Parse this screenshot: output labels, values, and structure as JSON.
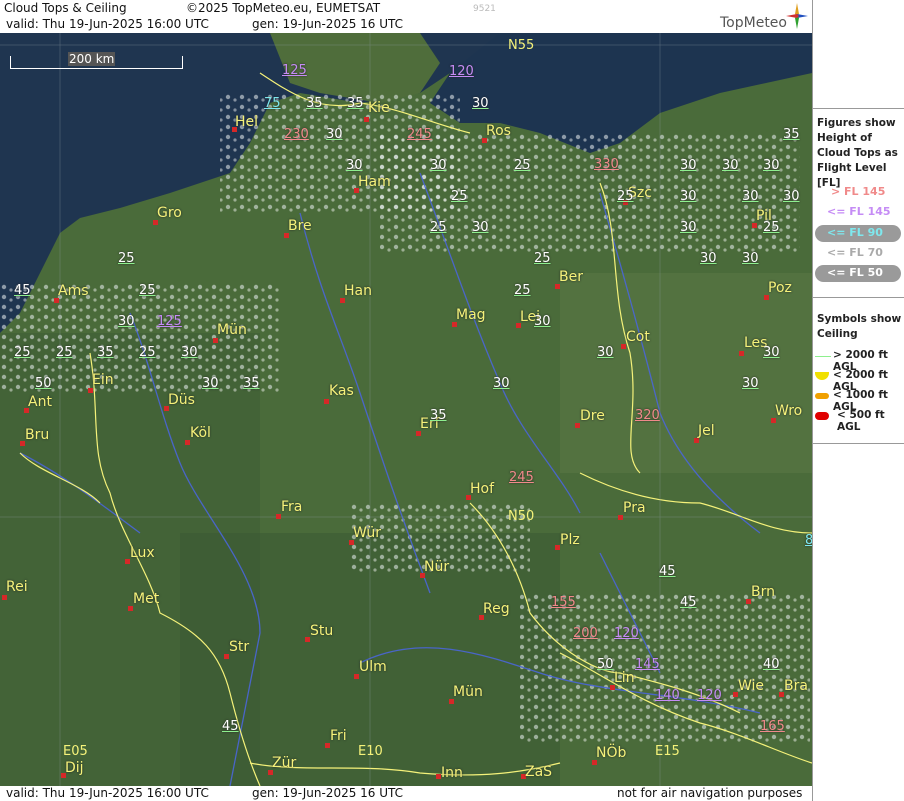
{
  "header": {
    "title": "Cloud Tops & Ceiling",
    "copyright": "©2025 TopMeteo.eu, EUMETSAT",
    "valid": "valid:  Thu  19-Jun-2025  16:00 UTC",
    "gen": "gen: 19-Jun-2025 16 UTC",
    "image_id": "9521",
    "logo": "TopMeteo"
  },
  "footer": {
    "valid": "valid:  Thu  19-Jun-2025  16:00 UTC",
    "gen": "gen: 19-Jun-2025 16 UTC",
    "disclaimer": "not for air navigation purposes"
  },
  "scale": {
    "label": "200 km"
  },
  "legend": {
    "tops_title": "Figures show Height of Cloud Tops as Flight Level  [FL]",
    "tops": [
      {
        "label": "> FL 145",
        "color": "#f08a8a"
      },
      {
        "label": "<= FL 145",
        "color": "#c58cf5"
      },
      {
        "label": "<= FL 90",
        "color": "#7ee8ee"
      },
      {
        "label": "<= FL 70",
        "color": "#aaaaaa"
      },
      {
        "label": "<= FL 50",
        "color": "#ffffff"
      }
    ],
    "ceiling_title": "Symbols show Ceiling",
    "ceiling": [
      {
        "label": "> 2000 ft AGL",
        "color": "#8ef08e"
      },
      {
        "label": "< 2000 ft AGL",
        "color": "#f0e000"
      },
      {
        "label": "< 1000 ft AGL",
        "color": "#f0a000"
      },
      {
        "label": "< 500 ft AGL",
        "color": "#e00000"
      }
    ]
  },
  "grid_labels": [
    "N55",
    "N50",
    "E05",
    "E10",
    "E15"
  ],
  "cities": [
    "Hel",
    "Kie",
    "Ros",
    "Ham",
    "Szc",
    "Gro",
    "Bre",
    "Pil",
    "Ber",
    "Poz",
    "Ams",
    "Han",
    "Mag",
    "Lei",
    "Cot",
    "Les",
    "Mün",
    "Ein",
    "Kas",
    "Ant",
    "Düs",
    "Dre",
    "Wro",
    "Bru",
    "Köl",
    "Erf",
    "Jel",
    "Hof",
    "Fra",
    "Pra",
    "Lux",
    "Wür",
    "Plz",
    "Nür",
    "Rei",
    "Met",
    "Reg",
    "Brn",
    "Stu",
    "Str",
    "Ulm",
    "Lin",
    "Wie",
    "Bra",
    "Mün",
    "Fri",
    "Zür",
    "Inn",
    "ZaS",
    "NÖb",
    "Dij"
  ],
  "flight_levels": [
    "125",
    "120",
    "75",
    "35",
    "35",
    "30",
    "230",
    "30",
    "245",
    "30",
    "35",
    "330",
    "25",
    "30",
    "25",
    "30",
    "30",
    "30",
    "25",
    "25",
    "30",
    "30",
    "30",
    "25",
    "30",
    "30",
    "25",
    "25",
    "25",
    "30",
    "30",
    "45",
    "25",
    "30",
    "30",
    "125",
    "25",
    "25",
    "35",
    "25",
    "30",
    "30",
    "30",
    "30",
    "35",
    "50",
    "30",
    "30",
    "35",
    "320",
    "245",
    "45",
    "45",
    "155",
    "200",
    "120",
    "50",
    "145",
    "40",
    "140",
    "120",
    "165",
    "45",
    "8"
  ]
}
